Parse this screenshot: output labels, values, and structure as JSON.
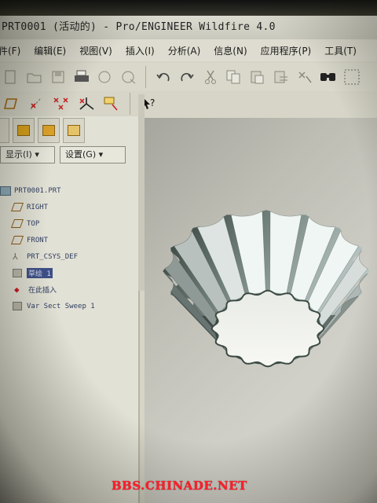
{
  "window": {
    "title": "PRT0001 (活动的) - Pro/ENGINEER Wildfire 4.0"
  },
  "menubar": {
    "items": [
      {
        "label": "件(F)"
      },
      {
        "label": "编辑(E)"
      },
      {
        "label": "视图(V)"
      },
      {
        "label": "插入(I)"
      },
      {
        "label": "分析(A)"
      },
      {
        "label": "信息(N)"
      },
      {
        "label": "应用程序(P)"
      },
      {
        "label": "工具(T)"
      }
    ]
  },
  "toolbar": {
    "row1_icons": [
      "new-icon",
      "open-icon",
      "save-icon",
      "print-icon",
      "email-icon",
      "send-icon",
      "undo-icon",
      "redo-icon",
      "cut-icon",
      "copy-icon",
      "paste-icon",
      "paste-special-icon",
      "regenerate-icon",
      "find-icon",
      "select-box-icon"
    ],
    "row2_icons": [
      "datum-plane-icon",
      "datum-axis-icon",
      "datum-point-icon",
      "csys-icon",
      "annotation-icon",
      "context-help-icon"
    ]
  },
  "model_tree": {
    "tabs": [
      "model-tree-tab",
      "layers-tab",
      "folder-tab",
      "favorites-tab"
    ],
    "show_label": "显示(I) ▾",
    "settings_label": "设置(G) ▾",
    "nodes": [
      {
        "label": "PRT0001.PRT",
        "icon": "part-icon",
        "selected": false
      },
      {
        "label": "RIGHT",
        "icon": "datum-plane-icon",
        "selected": false
      },
      {
        "label": "TOP",
        "icon": "datum-plane-icon",
        "selected": false
      },
      {
        "label": "FRONT",
        "icon": "datum-plane-icon",
        "selected": false
      },
      {
        "label": "PRT_CSYS_DEF",
        "icon": "csys-icon",
        "selected": false
      },
      {
        "label": "草绘 1",
        "icon": "sketch-icon",
        "selected": true
      },
      {
        "label": "在此插入",
        "icon": "insert-here-icon",
        "selected": false
      },
      {
        "label": "Var Sect Sweep 1",
        "icon": "sweep-icon",
        "selected": false
      }
    ]
  },
  "colors": {
    "viewport_bg": "#c8c8c0",
    "model_light": "#eef3f3",
    "model_dark": "#3f4c45",
    "selection": "#3d4f86",
    "watermark": "#ff1e2a"
  },
  "watermark": {
    "text": "BBS.CHINADE.NET"
  }
}
